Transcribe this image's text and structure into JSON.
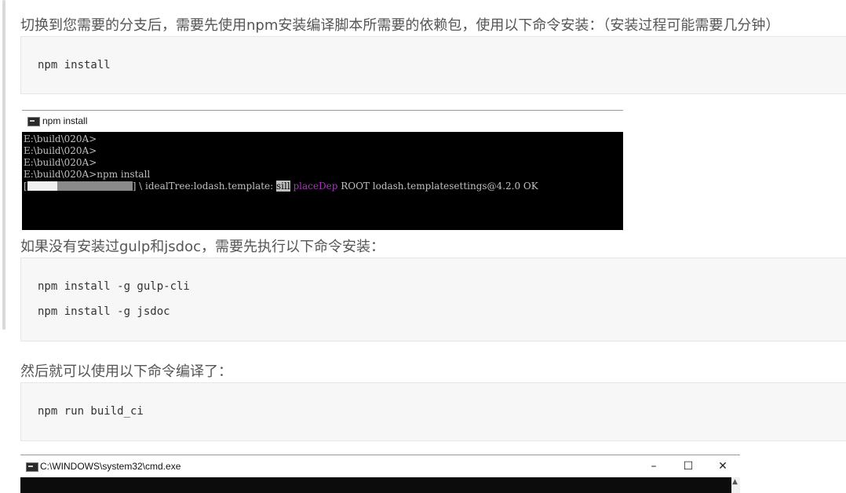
{
  "section1": {
    "text": "切换到您需要的分支后，需要先使用npm安装编译脚本所需要的依赖包，使用以下命令安装：（安装过程可能需要几分钟）",
    "code": [
      "npm install"
    ]
  },
  "console1": {
    "title": "npm install",
    "lines": [
      "E:\\build\\020A>",
      "E:\\build\\020A>",
      "E:\\build\\020A>",
      "E:\\build\\020A>npm install"
    ],
    "progress": {
      "open": "[",
      "close": "] \\ idealTree:lodash.template: ",
      "level": "sill",
      "action": "placeDep",
      "rest": " ROOT lodash.templatesettings@4.2.0 OK"
    }
  },
  "section2": {
    "text": "如果没有安装过gulp和jsdoc，需要先执行以下命令安装：",
    "code": [
      "npm install -g gulp-cli",
      "npm install -g jsdoc"
    ]
  },
  "section3": {
    "text": "然后就可以使用以下命令编译了：",
    "code": [
      "npm run build_ci"
    ]
  },
  "console2": {
    "title": "C:\\WINDOWS\\system32\\cmd.exe",
    "minimize": "–",
    "maximize": "☐",
    "close": "✕",
    "scroll_up": "▲"
  }
}
